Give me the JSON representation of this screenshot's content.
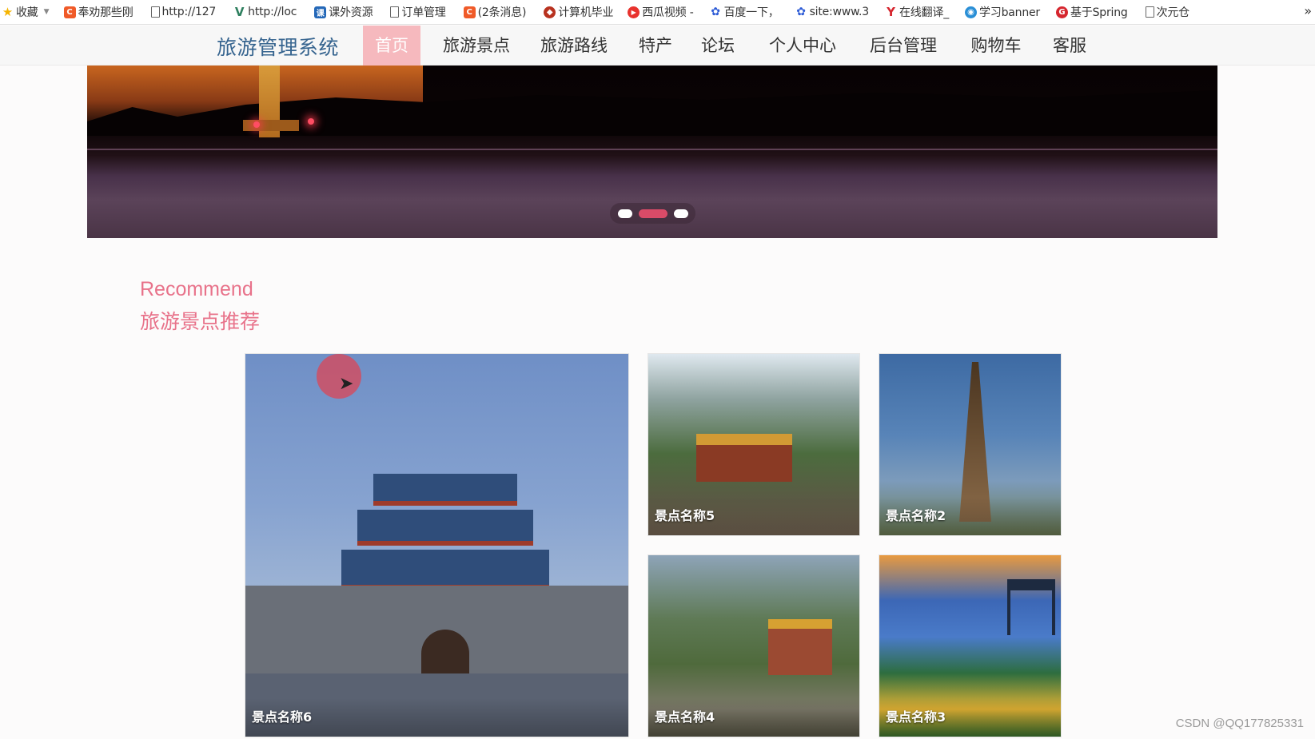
{
  "bookmarks": {
    "items": [
      {
        "label": "收藏",
        "icon": "star-icon",
        "color": "#f5b400",
        "glyph": "★"
      },
      {
        "label": "奉劝那些刚",
        "icon": "csdn-icon",
        "color": "#f05a28",
        "glyph": "C"
      },
      {
        "label": "http://127",
        "icon": "page-icon",
        "color": "#666666",
        "glyph": ""
      },
      {
        "label": "http://loc",
        "icon": "vue-icon",
        "color": "#2d7f5e",
        "glyph": "V"
      },
      {
        "label": "课外资源",
        "icon": "resource-icon",
        "color": "#2468b8",
        "glyph": "课"
      },
      {
        "label": "订单管理",
        "icon": "page-icon",
        "color": "#666666",
        "glyph": ""
      },
      {
        "label": "(2条消息)",
        "icon": "csdn-icon",
        "color": "#f05a28",
        "glyph": "C"
      },
      {
        "label": "计算机毕业",
        "icon": "pin-icon",
        "color": "#b8321f",
        "glyph": "◆"
      },
      {
        "label": "西瓜视频 -",
        "icon": "play-icon",
        "color": "#e8322d",
        "glyph": "▶"
      },
      {
        "label": "百度一下，",
        "icon": "baidu-paw-icon",
        "color": "#2d5bd6",
        "glyph": "✿"
      },
      {
        "label": "site:www.3",
        "icon": "baidu-paw-icon",
        "color": "#2d5bd6",
        "glyph": "✿"
      },
      {
        "label": "在线翻译_",
        "icon": "translate-icon",
        "color": "#d6262e",
        "glyph": "Y"
      },
      {
        "label": "学习banner",
        "icon": "globe-icon",
        "color": "#2a8fd6",
        "glyph": "◉"
      },
      {
        "label": "基于Spring",
        "icon": "spring-icon",
        "color": "#d6262e",
        "glyph": "G"
      },
      {
        "label": "次元仓",
        "icon": "page-icon",
        "color": "#666666",
        "glyph": ""
      }
    ],
    "more": "»"
  },
  "nav": {
    "brand": "旅游管理系统",
    "items": [
      "首页",
      "旅游景点",
      "旅游路线",
      "特产",
      "论坛",
      "个人中心",
      "后台管理",
      "购物车",
      "客服"
    ],
    "active_index": 0
  },
  "carousel": {
    "slide_count": 3,
    "active_slide": 2
  },
  "recommend": {
    "title_en": "Recommend",
    "title_cn": "旅游景点推荐",
    "cards": [
      {
        "name": "景点名称6"
      },
      {
        "name": "景点名称5"
      },
      {
        "name": "景点名称2"
      },
      {
        "name": "景点名称4"
      },
      {
        "name": "景点名称3"
      }
    ]
  },
  "watermark": "CSDN @QQ177825331"
}
